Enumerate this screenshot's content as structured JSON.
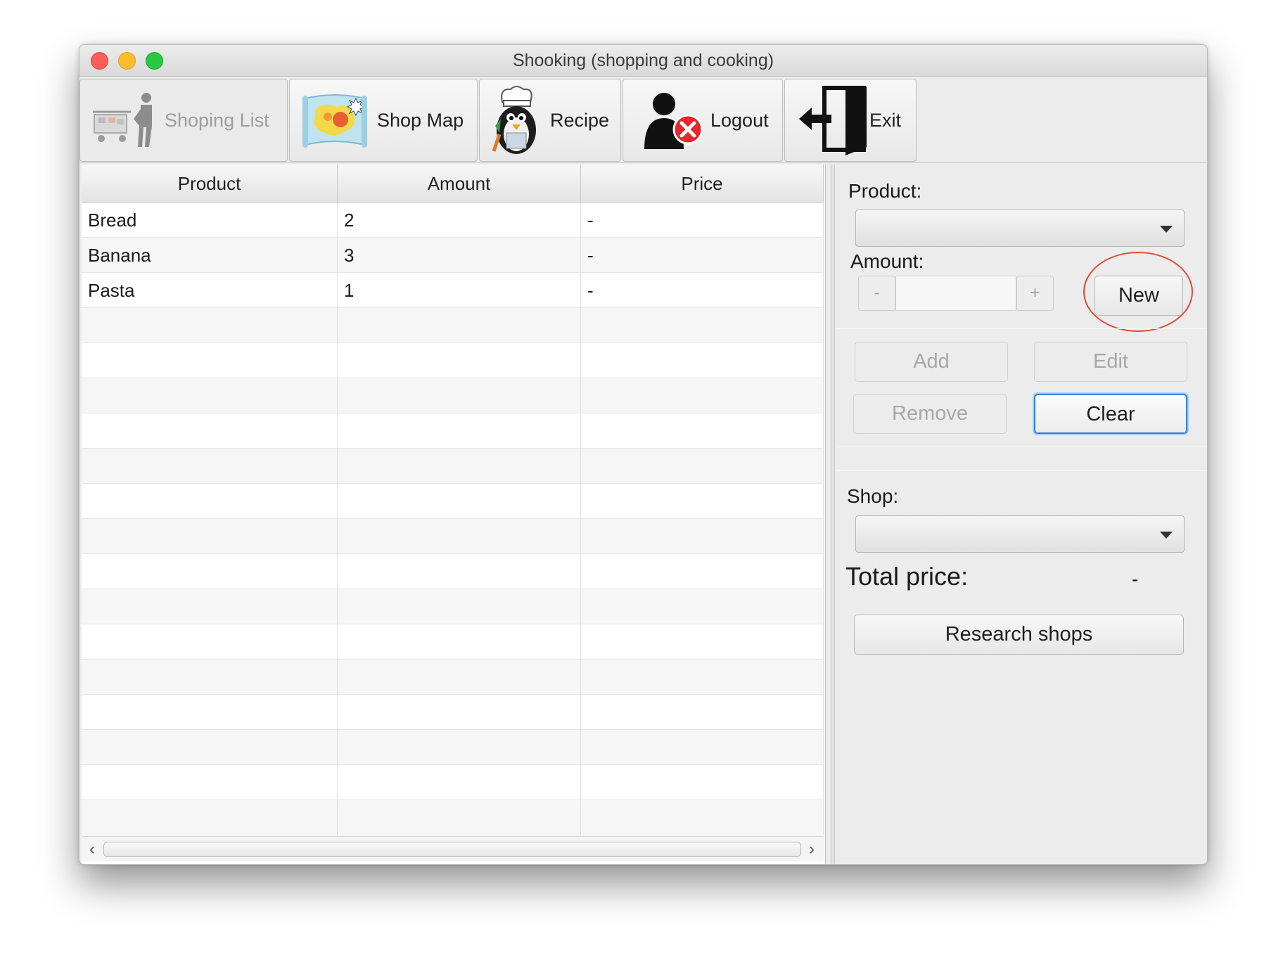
{
  "window": {
    "title": "Shooking (shopping and cooking)"
  },
  "toolbar": {
    "tabs": [
      {
        "label": "Shoping List",
        "icon": "shopping-cart-person-icon",
        "enabled": false
      },
      {
        "label": "Shop Map",
        "icon": "map-icon",
        "enabled": true
      },
      {
        "label": "Recipe",
        "icon": "chef-penguin-icon",
        "enabled": true
      },
      {
        "label": "Logout",
        "icon": "user-logout-icon",
        "enabled": true
      },
      {
        "label": "Exit",
        "icon": "exit-door-icon",
        "enabled": true
      }
    ]
  },
  "table": {
    "columns": [
      "Product",
      "Amount",
      "Price"
    ],
    "rows": [
      [
        "Bread",
        "2",
        "-"
      ],
      [
        "Banana",
        "3",
        "-"
      ],
      [
        "Pasta",
        "1",
        "-"
      ]
    ]
  },
  "form": {
    "product_label": "Product:",
    "product_value": "",
    "amount_label": "Amount:",
    "amount_value": "",
    "decrement": "-",
    "increment": "+",
    "new_button": "New",
    "add_button": "Add",
    "edit_button": "Edit",
    "remove_button": "Remove",
    "clear_button": "Clear",
    "shop_label": "Shop:",
    "shop_value": "",
    "total_price_label": "Total price:",
    "total_price_value": "-",
    "research_button": "Research shops"
  },
  "colors": {
    "focus_ring": "#2d83dc",
    "annotation": "#e04a3a",
    "traffic_close": "#fc5f57",
    "traffic_min": "#fdbc2e",
    "traffic_max": "#28c840"
  }
}
